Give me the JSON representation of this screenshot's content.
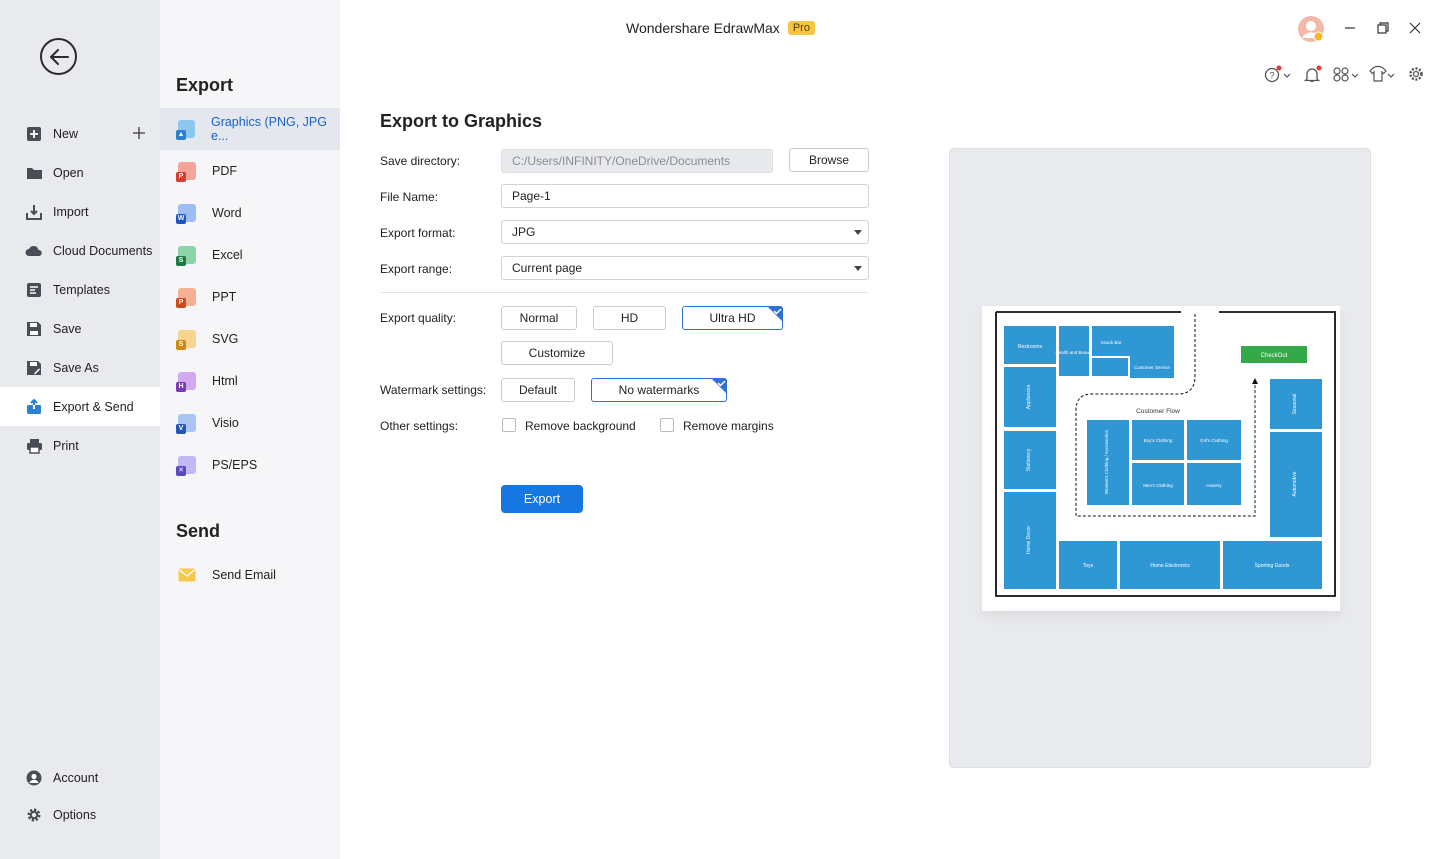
{
  "app": {
    "title": "Wondershare EdrawMax",
    "badge": "Pro"
  },
  "sidebar": {
    "items": [
      {
        "label": "New",
        "icon": "new-icon"
      },
      {
        "label": "Open",
        "icon": "folder-icon"
      },
      {
        "label": "Import",
        "icon": "import-icon"
      },
      {
        "label": "Cloud Documents",
        "icon": "cloud-icon"
      },
      {
        "label": "Templates",
        "icon": "templates-icon"
      },
      {
        "label": "Save",
        "icon": "save-icon"
      },
      {
        "label": "Save As",
        "icon": "save-as-icon"
      },
      {
        "label": "Export & Send",
        "icon": "export-icon",
        "active": true
      },
      {
        "label": "Print",
        "icon": "print-icon"
      }
    ],
    "bottom": [
      {
        "label": "Account",
        "icon": "account-icon"
      },
      {
        "label": "Options",
        "icon": "gear-icon"
      }
    ]
  },
  "export_panel": {
    "heading": "Export",
    "items": [
      {
        "label": "Graphics (PNG, JPG e...",
        "color": "#3a9fe0",
        "badge_color": "#2b7fd0",
        "badge": "▲",
        "active": true
      },
      {
        "label": "PDF",
        "color": "#f06a5a",
        "badge_color": "#d53c2e",
        "badge": "P"
      },
      {
        "label": "Word",
        "color": "#3f7ee8",
        "badge_color": "#1f56c4",
        "badge": "W"
      },
      {
        "label": "Excel",
        "color": "#33b068",
        "badge_color": "#1d7a45",
        "badge": "S"
      },
      {
        "label": "PPT",
        "color": "#f07a4a",
        "badge_color": "#d04a1e",
        "badge": "P"
      },
      {
        "label": "SVG",
        "color": "#f2b43c",
        "badge_color": "#d18a10",
        "badge": "S"
      },
      {
        "label": "Html",
        "color": "#a866d8",
        "badge_color": "#7a3bb0",
        "badge": "H"
      },
      {
        "label": "Visio",
        "color": "#4a86e8",
        "badge_color": "#2356b8",
        "badge": "V"
      },
      {
        "label": "PS/EPS",
        "color": "#8a78e8",
        "badge_color": "#5a48c0",
        "badge": "✕"
      }
    ],
    "send_heading": "Send",
    "send_items": [
      {
        "label": "Send Email",
        "color": "#f2c54a"
      }
    ]
  },
  "form": {
    "title": "Export to Graphics",
    "save_directory_label": "Save directory:",
    "save_directory_value": "C:/Users/INFINITY/OneDrive/Documents",
    "browse_label": "Browse",
    "file_name_label": "File Name:",
    "file_name_value": "Page-1",
    "export_format_label": "Export format:",
    "export_format_value": "JPG",
    "export_range_label": "Export range:",
    "export_range_value": "Current page",
    "export_quality_label": "Export quality:",
    "quality_options": [
      "Normal",
      "HD",
      "Ultra HD"
    ],
    "quality_selected": "Ultra HD",
    "customize_label": "Customize",
    "watermark_label": "Watermark settings:",
    "watermark_options": [
      "Default",
      "No watermarks"
    ],
    "watermark_selected": "No watermarks",
    "other_settings_label": "Other settings:",
    "remove_background_label": "Remove background",
    "remove_background_checked": false,
    "remove_margins_label": "Remove margins",
    "remove_margins_checked": false,
    "export_button_label": "Export"
  },
  "preview": {
    "blocks": [
      {
        "label": "Restrooms"
      },
      {
        "label": "Health and Beauty"
      },
      {
        "label": "Snack Bar"
      },
      {
        "label": "Customer Service"
      },
      {
        "label": "CheckOut"
      },
      {
        "label": "Appliances"
      },
      {
        "label": "Seasonal"
      },
      {
        "label": "Customer Flow"
      },
      {
        "label": "Women's Clothing / Accessories"
      },
      {
        "label": "Boy's Clothing"
      },
      {
        "label": "Girl's Clothing"
      },
      {
        "label": "Men's Clothing"
      },
      {
        "label": "Hosiery"
      },
      {
        "label": "Stationery"
      },
      {
        "label": "Automotive"
      },
      {
        "label": "Home Decor"
      },
      {
        "label": "Toys"
      },
      {
        "label": "Home Electronics"
      },
      {
        "label": "Sporting Goods"
      }
    ],
    "block_color": "#2f97d4",
    "checkout_color": "#35a84a"
  },
  "colors": {
    "accent": "#1677e0",
    "selected_border": "#2f6fd8",
    "notification_dot": "#e5393a"
  }
}
